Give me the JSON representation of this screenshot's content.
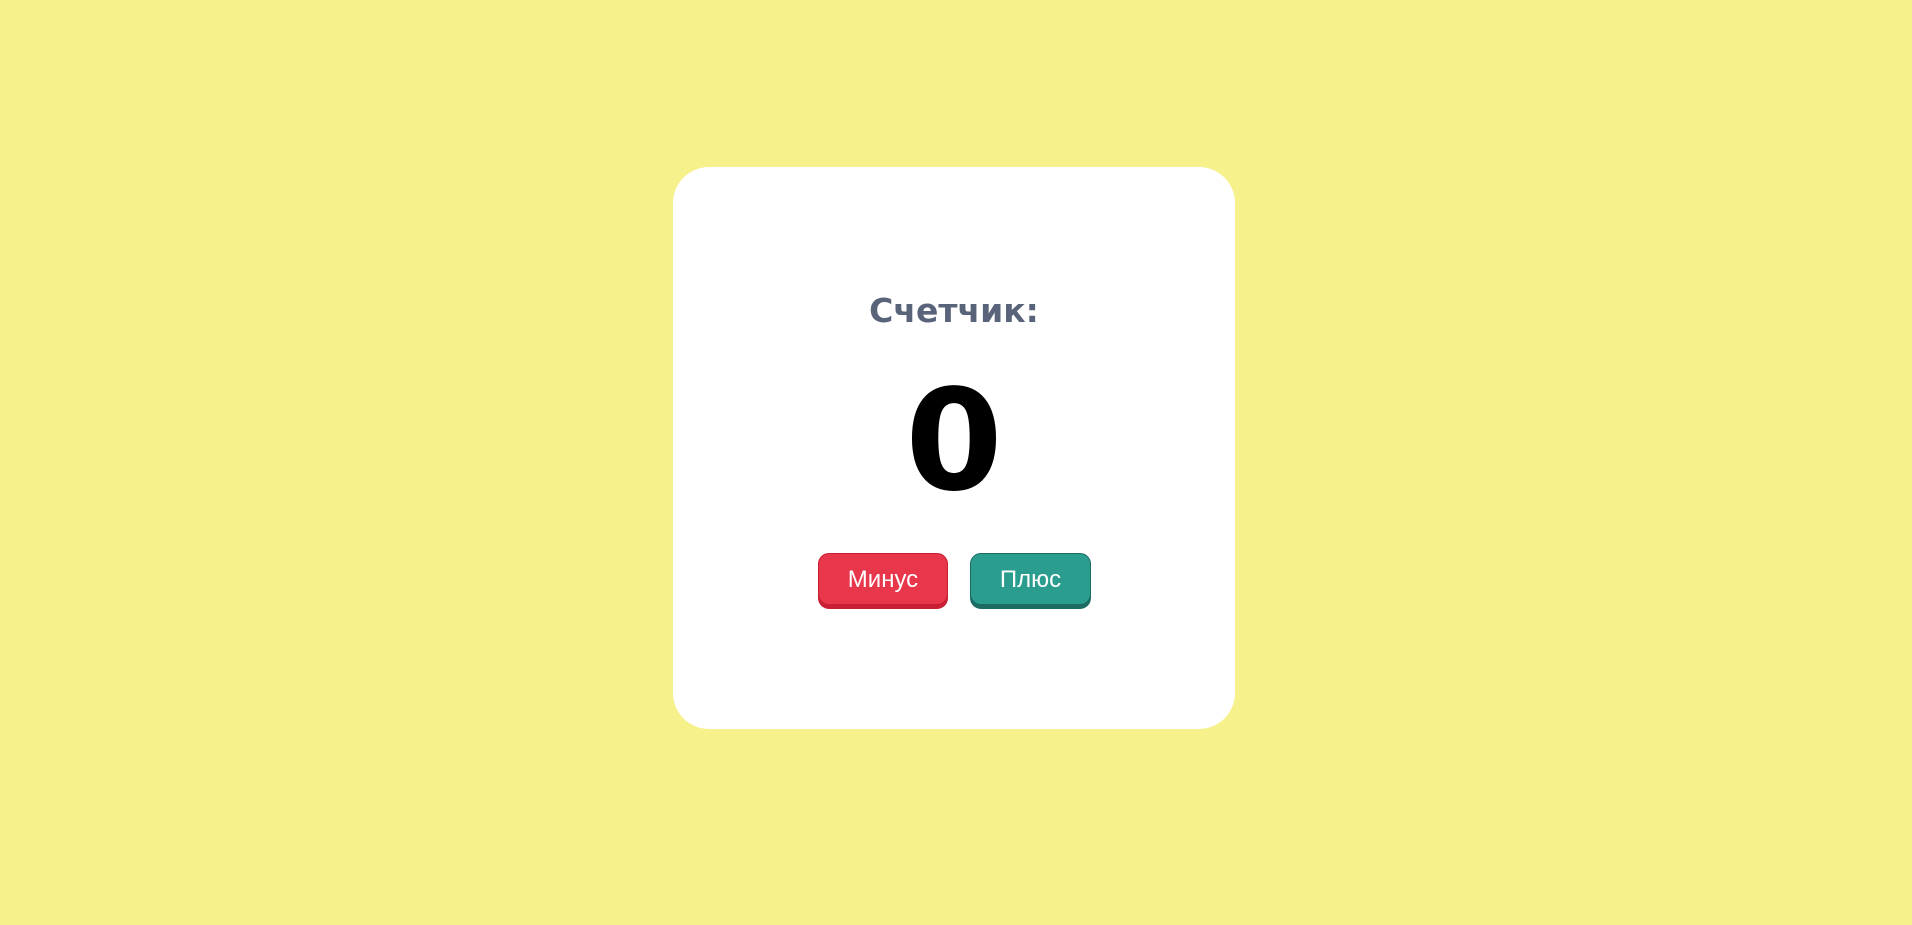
{
  "counter": {
    "title": "Счетчик:",
    "value": "0"
  },
  "buttons": {
    "minus_label": "Минус",
    "plus_label": "Плюс"
  },
  "colors": {
    "background": "#f6f18a",
    "card": "#ffffff",
    "title_text": "#596379",
    "minus_button": "#e8364a",
    "plus_button": "#2a9d8f"
  }
}
